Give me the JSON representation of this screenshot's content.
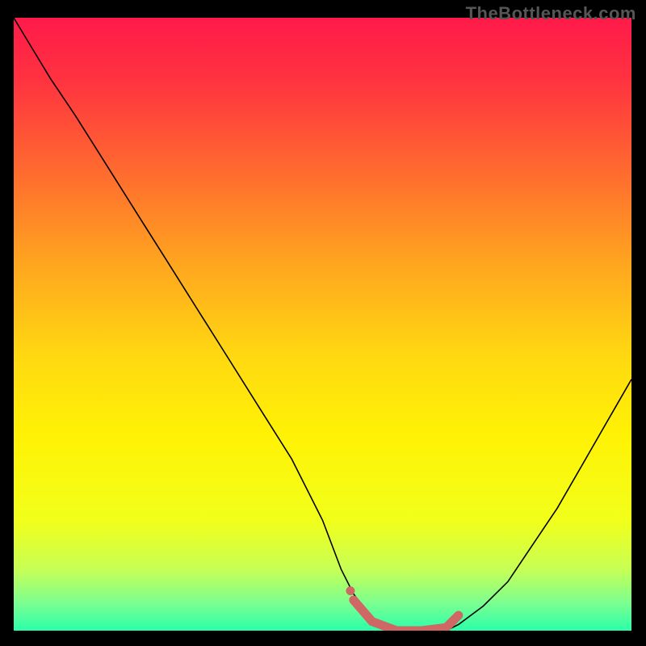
{
  "watermark": "TheBottleneck.com",
  "chart_data": {
    "type": "line",
    "title": "",
    "xlabel": "",
    "ylabel": "",
    "xlim": [
      0,
      100
    ],
    "ylim": [
      0,
      100
    ],
    "grid": false,
    "series": [
      {
        "name": "bottleneck-curve",
        "x": [
          0,
          3,
          6,
          10,
          15,
          20,
          25,
          30,
          35,
          40,
          45,
          50,
          53,
          55,
          58,
          62,
          66,
          70,
          72,
          76,
          80,
          84,
          88,
          92,
          96,
          100
        ],
        "y": [
          100,
          95,
          90,
          84,
          76,
          68,
          60,
          52,
          44,
          36,
          28,
          18,
          10,
          6,
          2,
          0,
          0,
          0,
          1,
          4,
          8,
          14,
          20,
          27,
          34,
          41
        ],
        "color": "#000000",
        "width": 1.6
      },
      {
        "name": "optimal-zone-highlight",
        "x": [
          55,
          58,
          62,
          66,
          70,
          72
        ],
        "y": [
          5,
          1.5,
          0,
          0,
          0.5,
          2.5
        ],
        "color": "#cf6765",
        "width": 11
      },
      {
        "name": "optimal-zone-dot",
        "x": [
          54.5
        ],
        "y": [
          6.5
        ],
        "color": "#cf6765",
        "width": 11
      }
    ],
    "background_gradient": {
      "stops": [
        {
          "offset": 0.0,
          "color": "#ff1a4a"
        },
        {
          "offset": 0.1,
          "color": "#ff3240"
        },
        {
          "offset": 0.25,
          "color": "#ff6a2f"
        },
        {
          "offset": 0.4,
          "color": "#ffa51f"
        },
        {
          "offset": 0.55,
          "color": "#ffd811"
        },
        {
          "offset": 0.68,
          "color": "#fff205"
        },
        {
          "offset": 0.82,
          "color": "#f2ff1a"
        },
        {
          "offset": 0.9,
          "color": "#c7ff55"
        },
        {
          "offset": 0.955,
          "color": "#7bff90"
        },
        {
          "offset": 1.0,
          "color": "#2bffaa"
        }
      ]
    }
  }
}
